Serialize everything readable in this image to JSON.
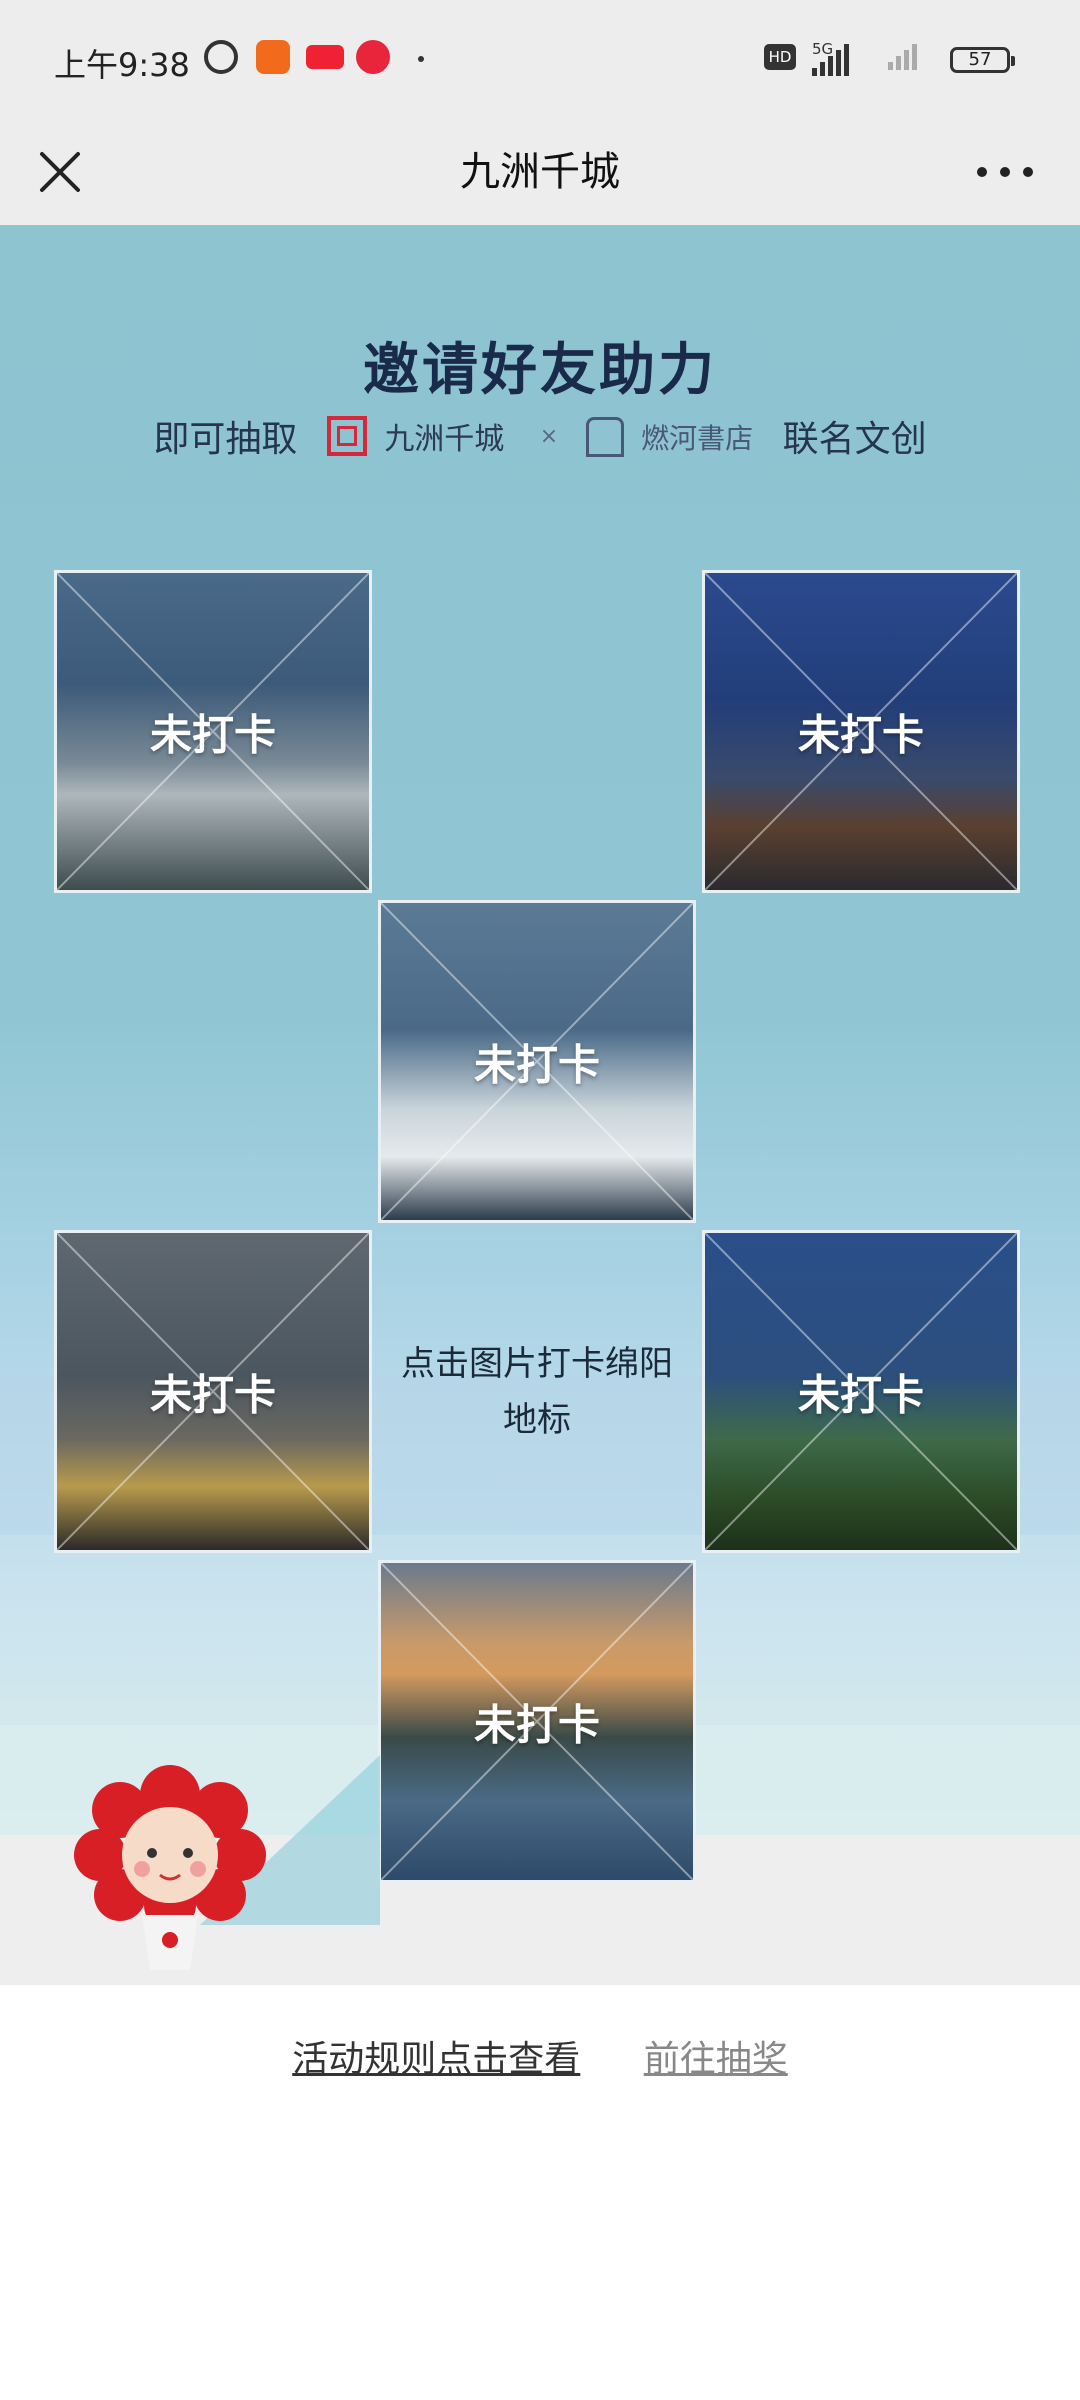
{
  "status_bar": {
    "time": "上午9:38",
    "network": "5G",
    "battery": "57"
  },
  "nav": {
    "title": "九洲千城",
    "close_icon": "close-icon",
    "more_icon": "more-icon"
  },
  "banner": {
    "headline": "邀请好友助力",
    "sub_prefix": "即可抽取",
    "brand1_name": "九洲千城",
    "brand_x": "×",
    "brand2_name": "燃河書店",
    "sub_suffix": "联名文创"
  },
  "tiles": [
    {
      "label": "未打卡"
    },
    {
      "label": "未打卡"
    },
    {
      "label": "未打卡"
    },
    {
      "label": "未打卡"
    },
    {
      "label": "未打卡"
    },
    {
      "label": "未打卡"
    }
  ],
  "center_hint": "点击图片打卡绵阳地标",
  "footer": {
    "rules_link": "活动规则点击查看",
    "draw_link": "前往抽奖"
  },
  "colors": {
    "headline": "#1a2a4a",
    "brand_red": "#d6283a",
    "page_bg_top": "#8ec4d0"
  }
}
